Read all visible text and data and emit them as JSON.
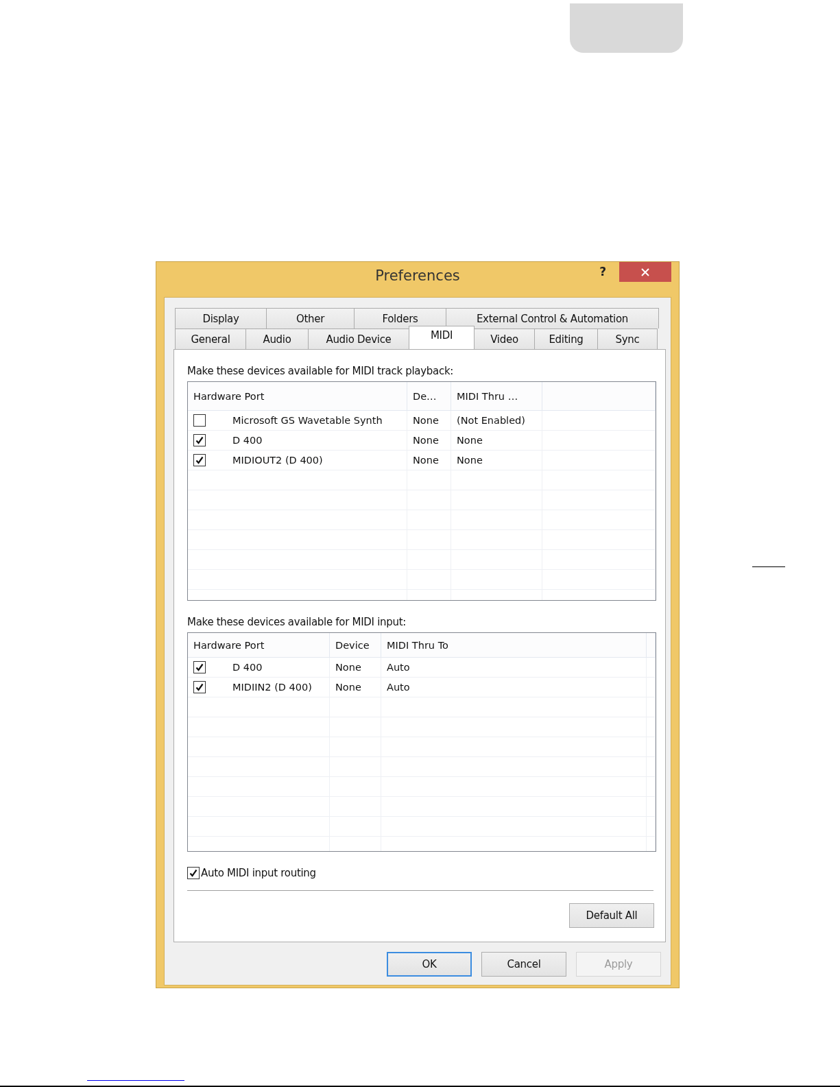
{
  "window": {
    "title": "Preferences",
    "help": "?"
  },
  "tab_rows": [
    [
      {
        "label": "Display",
        "selected": false
      },
      {
        "label": "Other",
        "selected": false
      },
      {
        "label": "Folders",
        "selected": false
      },
      {
        "label": "External Control & Automation",
        "selected": false
      }
    ],
    [
      {
        "label": "General",
        "selected": false
      },
      {
        "label": "Audio",
        "selected": false
      },
      {
        "label": "Audio Device",
        "selected": false
      },
      {
        "label": "MIDI",
        "selected": true
      },
      {
        "label": "Video",
        "selected": false
      },
      {
        "label": "Editing",
        "selected": false
      },
      {
        "label": "Sync",
        "selected": false
      }
    ]
  ],
  "sections": [
    {
      "label": "Make these devices available for MIDI track playback:",
      "columns": [
        "Hardware Port",
        "De…",
        "MIDI Thru …"
      ],
      "rows": [
        {
          "checked": false,
          "cells": [
            "Microsoft GS Wavetable Synth",
            "None",
            "(Not Enabled)"
          ]
        },
        {
          "checked": true,
          "cells": [
            "D 400",
            "None",
            "None"
          ]
        },
        {
          "checked": true,
          "cells": [
            "MIDIOUT2 (D 400)",
            "None",
            "None"
          ]
        }
      ]
    },
    {
      "label": "Make these devices available for MIDI input:",
      "columns": [
        "Hardware Port",
        "Device",
        "MIDI Thru To"
      ],
      "rows": [
        {
          "checked": true,
          "cells": [
            "D 400",
            "None",
            "Auto"
          ]
        },
        {
          "checked": true,
          "cells": [
            "MIDIIN2 (D 400)",
            "None",
            "Auto"
          ]
        }
      ]
    }
  ],
  "auto_routing": {
    "label": "Auto MIDI input routing",
    "checked": true
  },
  "panel_button": {
    "label": "Default All"
  },
  "buttons": [
    {
      "label": "OK",
      "default": true,
      "disabled": false
    },
    {
      "label": "Cancel",
      "default": false,
      "disabled": false
    },
    {
      "label": "Apply",
      "default": false,
      "disabled": true
    }
  ]
}
